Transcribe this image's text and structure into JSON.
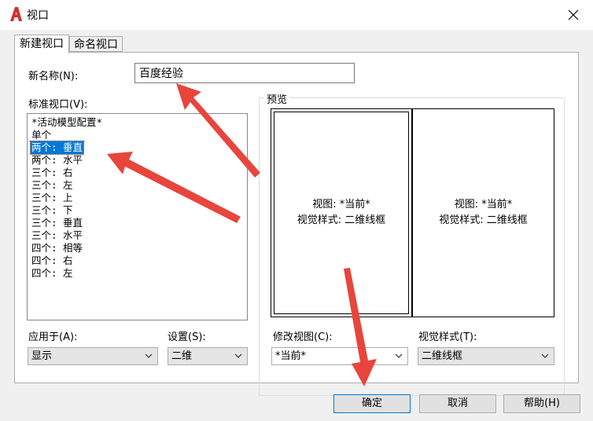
{
  "window": {
    "title": "视口",
    "close_icon": "close-icon"
  },
  "tabs": [
    {
      "label": "新建视口"
    },
    {
      "label": "命名视口"
    }
  ],
  "name_field": {
    "label": "新名称(N):",
    "value": "百度经验"
  },
  "standard_viewports": {
    "label": "标准视口(V):",
    "items": [
      "*活动模型配置*",
      "单个",
      "两个: 垂直",
      "两个: 水平",
      "三个: 右",
      "三个: 左",
      "三个: 上",
      "三个: 下",
      "三个: 垂直",
      "三个: 水平",
      "四个: 相等",
      "四个: 右",
      "四个: 左"
    ],
    "selected_index": 2
  },
  "preview": {
    "label": "预览",
    "left": {
      "view": "视图: *当前*",
      "style": "视觉样式: 二维线框"
    },
    "right": {
      "view": "视图: *当前*",
      "style": "视觉样式: 二维线框"
    }
  },
  "apply_to": {
    "label": "应用于(A):",
    "value": "显示"
  },
  "setup": {
    "label": "设置(S):",
    "value": "二维"
  },
  "change_view": {
    "label": "修改视图(C):",
    "value": "*当前*"
  },
  "visual_style": {
    "label": "视觉样式(T):",
    "value": "二维线框"
  },
  "buttons": {
    "ok": "确定",
    "cancel": "取消",
    "help": "帮助(H)"
  },
  "colors": {
    "selection": "#0078d7",
    "annotation_arrow": "#e8453c",
    "app_icon": "#d32f2f"
  }
}
